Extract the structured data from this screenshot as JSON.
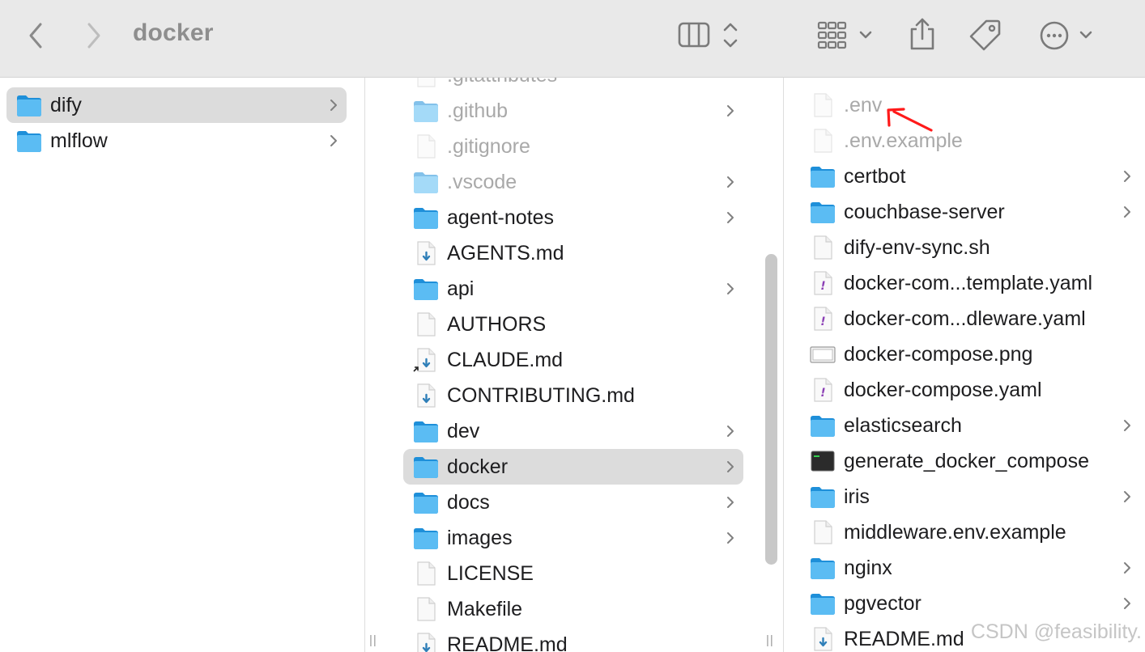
{
  "window": {
    "title": "docker"
  },
  "toolbar": {
    "back_icon": "chevron-left-icon",
    "forward_icon": "chevron-right-icon",
    "view_icon": "column-view-icon",
    "group_icon": "grid-view-icon",
    "share_icon": "share-icon",
    "tag_icon": "tag-icon",
    "more_icon": "ellipsis-circle-icon"
  },
  "column1": {
    "items": [
      {
        "name": "dify",
        "kind": "folder",
        "selected": true,
        "has_children": true
      },
      {
        "name": "mlflow",
        "kind": "folder",
        "selected": false,
        "has_children": true
      }
    ]
  },
  "column2": {
    "items": [
      {
        "name": ".gitattributes",
        "kind": "file",
        "dim": true
      },
      {
        "name": ".github",
        "kind": "folder",
        "dim": true,
        "has_children": true
      },
      {
        "name": ".gitignore",
        "kind": "file",
        "dim": true
      },
      {
        "name": ".vscode",
        "kind": "folder",
        "dim": true,
        "has_children": true
      },
      {
        "name": "agent-notes",
        "kind": "folder",
        "has_children": true
      },
      {
        "name": "AGENTS.md",
        "kind": "markdown"
      },
      {
        "name": "api",
        "kind": "folder",
        "has_children": true
      },
      {
        "name": "AUTHORS",
        "kind": "file"
      },
      {
        "name": "CLAUDE.md",
        "kind": "markdown-alias"
      },
      {
        "name": "CONTRIBUTING.md",
        "kind": "markdown"
      },
      {
        "name": "dev",
        "kind": "folder",
        "has_children": true
      },
      {
        "name": "docker",
        "kind": "folder",
        "has_children": true,
        "selected": true
      },
      {
        "name": "docs",
        "kind": "folder",
        "has_children": true
      },
      {
        "name": "images",
        "kind": "folder",
        "has_children": true
      },
      {
        "name": "LICENSE",
        "kind": "file"
      },
      {
        "name": "Makefile",
        "kind": "file"
      },
      {
        "name": "README.md",
        "kind": "markdown"
      }
    ]
  },
  "column3": {
    "items": [
      {
        "name": ".env",
        "kind": "file",
        "dim": true
      },
      {
        "name": ".env.example",
        "kind": "file",
        "dim": true
      },
      {
        "name": "certbot",
        "kind": "folder",
        "has_children": true
      },
      {
        "name": "couchbase-server",
        "kind": "folder",
        "has_children": true
      },
      {
        "name": "dify-env-sync.sh",
        "kind": "file"
      },
      {
        "name": "docker-com...template.yaml",
        "kind": "yaml"
      },
      {
        "name": "docker-com...dleware.yaml",
        "kind": "yaml"
      },
      {
        "name": "docker-compose.png",
        "kind": "image"
      },
      {
        "name": "docker-compose.yaml",
        "kind": "yaml"
      },
      {
        "name": "elasticsearch",
        "kind": "folder",
        "has_children": true
      },
      {
        "name": "generate_docker_compose",
        "kind": "executable"
      },
      {
        "name": "iris",
        "kind": "folder",
        "has_children": true
      },
      {
        "name": "middleware.env.example",
        "kind": "file"
      },
      {
        "name": "nginx",
        "kind": "folder",
        "has_children": true
      },
      {
        "name": "pgvector",
        "kind": "folder",
        "has_children": true
      },
      {
        "name": "README.md",
        "kind": "markdown"
      }
    ]
  },
  "colors": {
    "toolbar_bg": "#e9e9e9",
    "selection_bg": "#dcdcdc",
    "folder_blue": "#3fa9ec",
    "annotation_red": "#ff0000"
  },
  "watermark": "CSDN @feasibility."
}
